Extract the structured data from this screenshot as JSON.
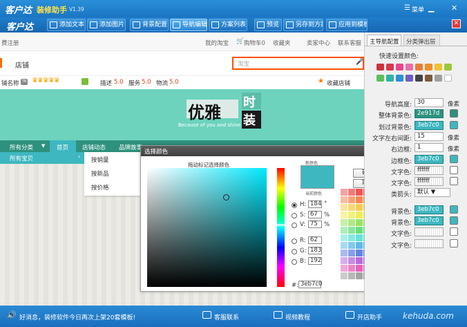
{
  "app": {
    "logo": "客户达",
    "title_accent": "装修助手",
    "version": "V1.39",
    "menu": "菜单"
  },
  "toolbar": {
    "logo": "客户达",
    "items": [
      {
        "label": "添加文本"
      },
      {
        "label": "添加图片"
      },
      {
        "label": "背景配置"
      },
      {
        "label": "导航编辑"
      },
      {
        "label": "方案列表"
      },
      {
        "label": "预览"
      },
      {
        "label": "另存到方案"
      },
      {
        "label": "应用到模板"
      }
    ]
  },
  "shop_top": {
    "register": "费注册",
    "links": [
      "我的淘宝",
      "购物车0",
      "收藏夹",
      "卖家中心",
      "联系客服"
    ]
  },
  "shop": {
    "store_label": "店铺",
    "search_placeholder": "淘宝",
    "name_label": "铺名称",
    "ratings": [
      {
        "label": "描述",
        "value": "5.0"
      },
      {
        "label": "服务",
        "value": "5.0"
      },
      {
        "label": "物流",
        "value": "5.0"
      }
    ],
    "favorite": "收藏店铺",
    "banner_title": "优雅",
    "banner_sub1": "时",
    "banner_sub2": "装",
    "banner_tagline": "Because of you and shine",
    "nav": [
      "所有分类",
      "首页",
      "店铺动态",
      "品牌故事"
    ],
    "all_products": "所有宝贝",
    "submenu": [
      "按销量",
      "按新品",
      "按价格"
    ]
  },
  "dialog": {
    "title": "选择颜色",
    "drag_label": "拖动标记选择颜色",
    "current_label": "新颜色",
    "old_label": "当前颜色",
    "ok": "确定",
    "cancel": "取消",
    "hsv": [
      {
        "label": "H:",
        "value": "184",
        "unit": "°"
      },
      {
        "label": "S:",
        "value": "67",
        "unit": "%"
      },
      {
        "label": "V:",
        "value": "75",
        "unit": "%"
      }
    ],
    "rgb": [
      {
        "label": "R:",
        "value": "62"
      },
      {
        "label": "G:",
        "value": "183"
      },
      {
        "label": "B:",
        "value": "192"
      }
    ],
    "hex_label": "#:",
    "hex": "3eb7c0",
    "current_color": "#3eb7c0"
  },
  "panel": {
    "tabs": [
      "主导航配置",
      "分类弹出层"
    ],
    "quick_colors_label": "快速设置颜色:",
    "quick_colors": [
      "#c8343a",
      "#d9364f",
      "#e8468c",
      "#e86fa8",
      "#ea7d34",
      "#f08e2a",
      "#f2c230",
      "#9bc93a",
      "#5bbf5c",
      "#2fb3a9",
      "#2b90d6",
      "#6b5ec6",
      "#444444",
      "#7c5b3d",
      "#a0a0a0",
      "#ffffff"
    ],
    "rows": [
      {
        "label": "导航高度:",
        "value": "30",
        "unit": "像素"
      },
      {
        "label": "整体背景色:",
        "value": "2e917d",
        "swatch": "#2e917d"
      },
      {
        "label": "划过背景色:",
        "value": "3eb7c0",
        "swatch": "#3eb7c0"
      },
      {
        "label": "文字左右间距:",
        "value": "15",
        "unit": "像素"
      },
      {
        "label": "右边框:",
        "value": "1",
        "unit": "像素"
      },
      {
        "label": "边框色:",
        "value": "3eb7c0",
        "swatch": "#3eb7c0"
      },
      {
        "label": "文字色:",
        "value": "ffffff",
        "swatch": "#ffffff"
      },
      {
        "label": "文字色:",
        "value": "ffffff",
        "swatch": "#ffffff"
      }
    ],
    "arrow_label": "类箭头:",
    "arrow_value": "默认",
    "rows2": [
      {
        "label": "背景色:",
        "value": "3eb7c0",
        "swatch": "#3eb7c0"
      },
      {
        "label": "背景色:",
        "value": "3eb7c0",
        "swatch": "#3eb7c0"
      },
      {
        "label": "文字色:",
        "value": "",
        "swatch": "#ffffff"
      },
      {
        "label": "文字色:",
        "value": "",
        "swatch": "#ffffff"
      }
    ]
  },
  "status": {
    "news": "好消息，装修软件今日再次上架20套模板!",
    "support": "客服联系",
    "video": "视频教程",
    "open_helper": "开店助手",
    "site": "kehuda.com"
  }
}
